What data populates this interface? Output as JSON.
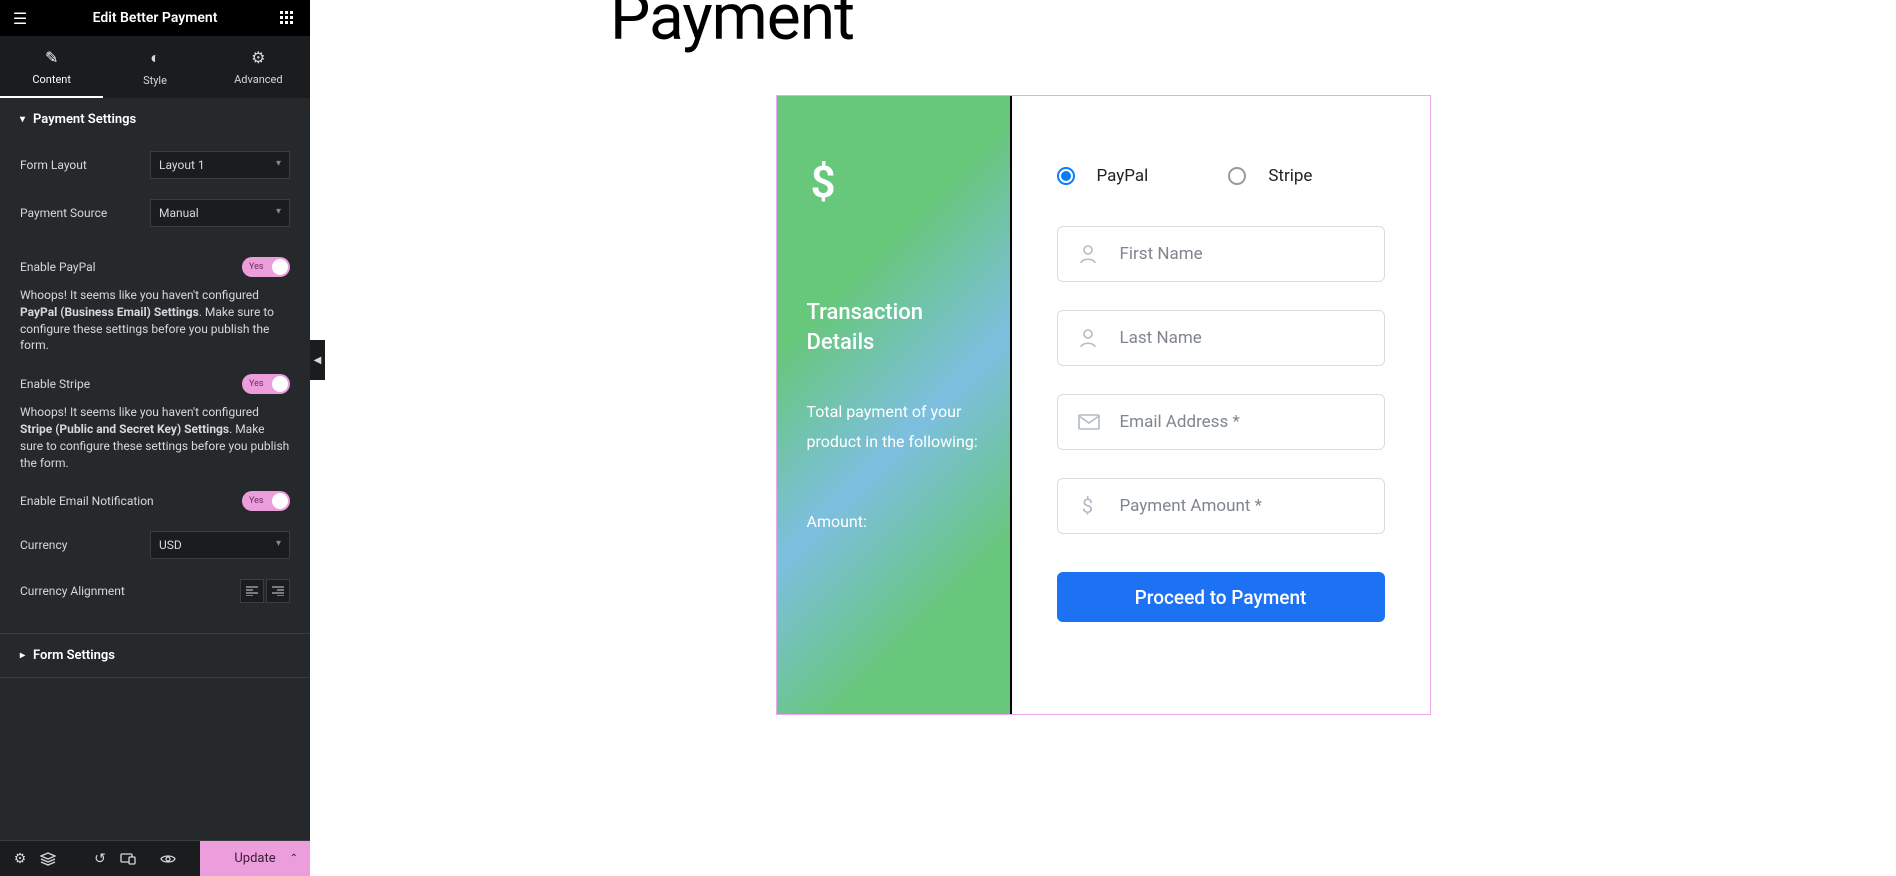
{
  "sidebar": {
    "title": "Edit Better Payment",
    "tabs": {
      "content": "Content",
      "style": "Style",
      "advanced": "Advanced"
    },
    "sections": {
      "payment_settings": "Payment Settings",
      "form_settings": "Form Settings"
    },
    "controls": {
      "form_layout": {
        "label": "Form Layout",
        "value": "Layout 1"
      },
      "payment_source": {
        "label": "Payment Source",
        "value": "Manual"
      },
      "enable_paypal": {
        "label": "Enable PayPal",
        "value": "Yes"
      },
      "paypal_warning_pre": "Whoops! It seems like you haven't configured ",
      "paypal_warning_strong": "PayPal (Business Email) Settings",
      "paypal_warning_post": ". Make sure to configure these settings before you publish the form.",
      "enable_stripe": {
        "label": "Enable Stripe",
        "value": "Yes"
      },
      "stripe_warning_pre": "Whoops! It seems like you haven't configured ",
      "stripe_warning_strong": "Stripe (Public and Secret Key) Settings",
      "stripe_warning_post": ". Make sure to configure these settings before you publish the form.",
      "enable_email": {
        "label": "Enable Email Notification",
        "value": "Yes"
      },
      "currency": {
        "label": "Currency",
        "value": "USD"
      },
      "currency_align": {
        "label": "Currency Alignment"
      }
    },
    "footer": {
      "update": "Update"
    }
  },
  "canvas": {
    "page_title": "Payment",
    "left_panel": {
      "title": "Transaction Details",
      "description": "Total payment of your product in the following:",
      "amount_label": "Amount:"
    },
    "form": {
      "paypal": "PayPal",
      "stripe": "Stripe",
      "first_name": "First Name",
      "last_name": "Last Name",
      "email": "Email Address *",
      "amount": "Payment Amount *",
      "submit": "Proceed to Payment"
    }
  }
}
